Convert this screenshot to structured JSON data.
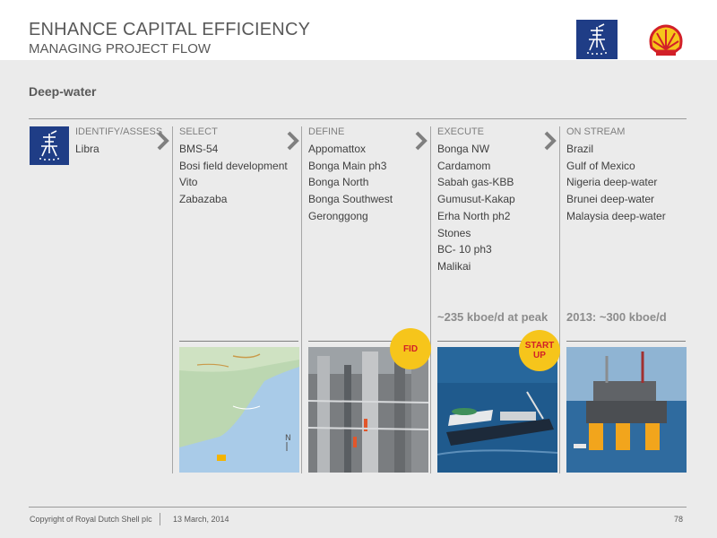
{
  "header": {
    "title": "ENHANCE CAPITAL EFFICIENCY",
    "subtitle": "MANAGING PROJECT FLOW"
  },
  "section_title": "Deep-water",
  "stages": [
    {
      "header": "IDENTIFY/ASSESS",
      "items": [
        "Libra"
      ]
    },
    {
      "header": "SELECT",
      "items": [
        "BMS-54",
        "Bosi field development",
        "Vito",
        "Zabazaba"
      ]
    },
    {
      "header": "DEFINE",
      "items": [
        "Appomattox",
        "Bonga Main ph3",
        "Bonga North",
        "Bonga Southwest",
        "Geronggong"
      ]
    },
    {
      "header": "EXECUTE",
      "items": [
        "Bonga NW",
        "Cardamom",
        "Sabah gas-KBB",
        "Gumusut-Kakap",
        "Erha North ph2",
        "Stones",
        "BC- 10 ph3",
        "Malikai"
      ]
    },
    {
      "header": "ON STREAM",
      "items": [
        "Brazil",
        "Gulf of Mexico",
        "Nigeria deep-water",
        "Brunei deep-water",
        "Malaysia deep-water"
      ]
    }
  ],
  "metrics": {
    "execute": "~235 kboe/d at peak",
    "onstream": "2013: ~300 kboe/d"
  },
  "badges": {
    "fid": "FID",
    "startup_line1": "START",
    "startup_line2": "UP"
  },
  "footer": {
    "copyright": "Copyright of Royal Dutch Shell plc",
    "date": "13 March, 2014",
    "page": "78"
  },
  "colors": {
    "brand_blue": "#1f3d86",
    "shell_yellow": "#f6c51b",
    "shell_red": "#d22028"
  },
  "icons": [
    "offshore-platform-icon",
    "shell-pecten-logo",
    "chevron-right-icon"
  ]
}
